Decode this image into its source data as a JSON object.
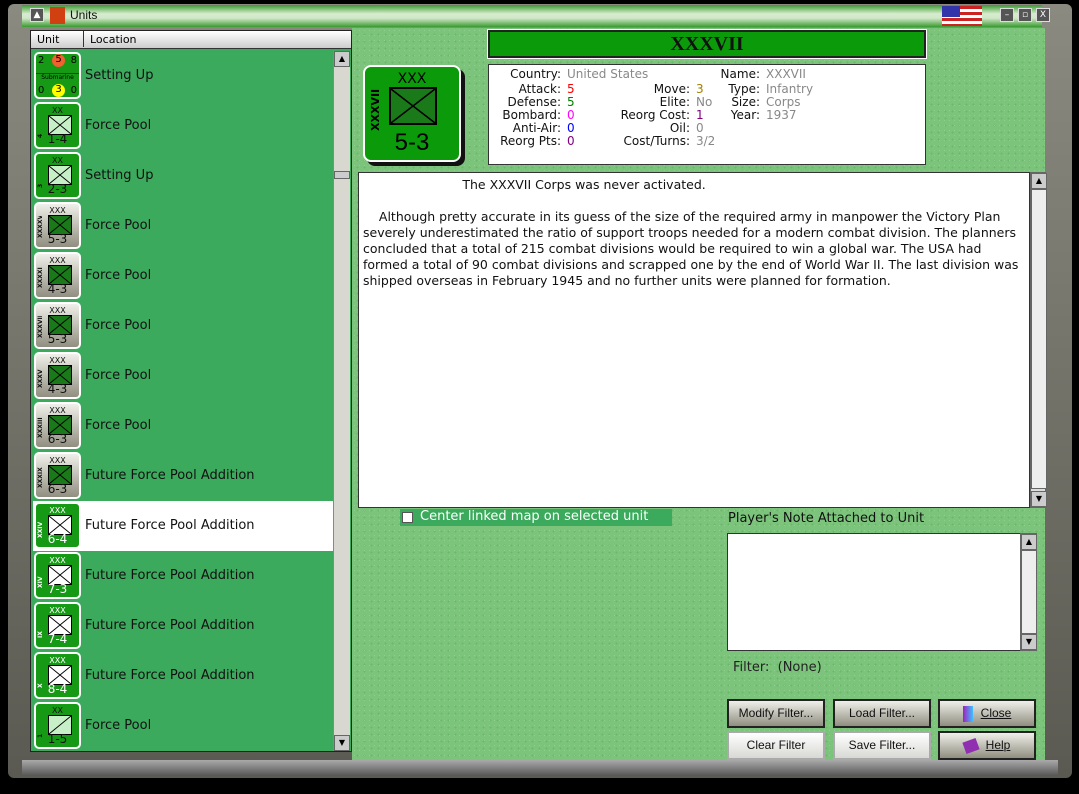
{
  "window": {
    "title": "Units"
  },
  "list": {
    "headers": [
      "Unit",
      "Location"
    ],
    "rows": [
      {
        "kind": "sub",
        "top": [
          "2",
          "5",
          "8"
        ],
        "label": "Submarine",
        "bottom": [
          "0",
          "3",
          "0"
        ],
        "location": "Setting Up"
      },
      {
        "size": "XX",
        "name": "4",
        "strength": "1-4",
        "style": "light",
        "location": "Force Pool"
      },
      {
        "size": "XX",
        "name": "3",
        "strength": "2-3",
        "style": "light",
        "location": "Setting Up"
      },
      {
        "size": "XXX",
        "name": "XXXXV",
        "strength": "5-3",
        "style": "dark",
        "location": "Force Pool"
      },
      {
        "size": "XXX",
        "name": "XXXXI",
        "strength": "4-3",
        "style": "dark",
        "location": "Force Pool"
      },
      {
        "size": "XXX",
        "name": "XXXVII",
        "strength": "5-3",
        "style": "dark",
        "location": "Force Pool"
      },
      {
        "size": "XXX",
        "name": "XXXV",
        "strength": "4-3",
        "style": "dark",
        "location": "Force Pool"
      },
      {
        "size": "XXX",
        "name": "XXXIII",
        "strength": "6-3",
        "style": "dark",
        "location": "Force Pool"
      },
      {
        "size": "XXX",
        "name": "XXXIX",
        "strength": "6-3",
        "style": "dark",
        "location": "Future Force Pool Addition"
      },
      {
        "size": "XXX",
        "name": "XXIV",
        "strength": "6-4",
        "style": "white",
        "location": "Future Force Pool Addition",
        "selected": true
      },
      {
        "size": "XXX",
        "name": "XIV",
        "strength": "7-3",
        "style": "white",
        "location": "Future Force Pool Addition"
      },
      {
        "size": "XXX",
        "name": "IX",
        "strength": "7-4",
        "style": "white",
        "location": "Future Force Pool Addition"
      },
      {
        "size": "XXX",
        "name": "X",
        "strength": "8-4",
        "style": "white",
        "location": "Future Force Pool Addition"
      },
      {
        "size": "XX",
        "name": "1",
        "strength": "1-5",
        "style": "light",
        "location": "Force Pool"
      }
    ]
  },
  "unit": {
    "title": "XXXVII",
    "size": "XXX",
    "name": "XXXVII",
    "strength": "5-3",
    "fields": [
      {
        "label": "Country:",
        "value": "United States",
        "color": "#888888"
      },
      {
        "label": "Attack:",
        "value": "5",
        "color": "#ff0000"
      },
      {
        "label": "Defense:",
        "value": "5",
        "color": "#008000"
      },
      {
        "label": "Bombard:",
        "value": "0",
        "color": "#ff00ff"
      },
      {
        "label": "Anti-Air:",
        "value": "0",
        "color": "#0000ff"
      },
      {
        "label": "Reorg Pts:",
        "value": "0",
        "color": "#800080"
      },
      {
        "label": "Move:",
        "value": "3",
        "color": "#a08000"
      },
      {
        "label": "Elite:",
        "value": "No",
        "color": "#888888"
      },
      {
        "label": "Reorg Cost:",
        "value": "1",
        "color": "#800080"
      },
      {
        "label": "Oil:",
        "value": "0",
        "color": "#888888"
      },
      {
        "label": "Cost/Turns:",
        "value": "3/2",
        "color": "#888888"
      },
      {
        "label": "Name:",
        "value": "XXXVII",
        "color": "#888888"
      },
      {
        "label": "Type:",
        "value": "Infantry",
        "color": "#888888"
      },
      {
        "label": "Size:",
        "value": "Corps",
        "color": "#888888"
      },
      {
        "label": "Year:",
        "value": "1937",
        "color": "#888888"
      }
    ],
    "description": "                         The XXXVII Corps was never activated.\n\n    Although pretty accurate in its guess of the size of the required army in manpower the Victory Plan severely underestimated the ratio of support troops needed for a modern combat division. The planners concluded that a total of 215 combat divisions would be required to win a global war. The USA had formed a total of 90 combat divisions and scrapped one by the end of World War II. The last division was shipped overseas in February 1945 and no further units were planned for formation."
  },
  "controls": {
    "center_map": "Center linked map on selected unit",
    "note_label": "Player's Note Attached to Unit",
    "filter_label": "Filter:",
    "filter_value": "(None)",
    "modify": "Modify Filter...",
    "load": "Load Filter...",
    "close": "Close",
    "clear": "Clear Filter",
    "save": "Save Filter...",
    "help": "Help"
  }
}
